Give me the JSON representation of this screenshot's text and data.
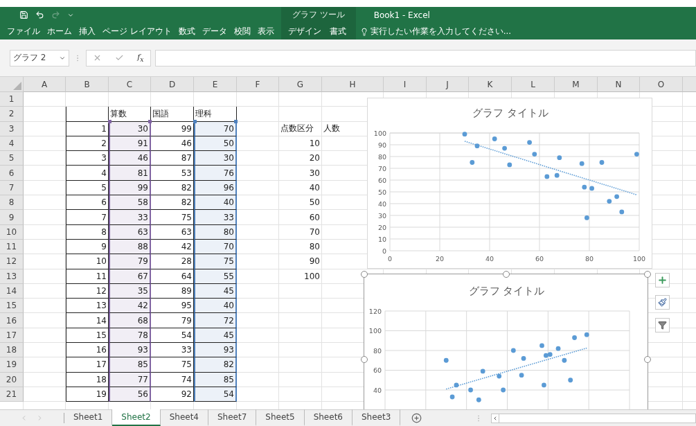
{
  "window": {
    "title": "Book1 - Excel"
  },
  "ribbon": {
    "tab_group": "グラフ ツール",
    "tabs": [
      {
        "label": "ファイル",
        "kind": "main"
      },
      {
        "label": "ホーム",
        "kind": "main"
      },
      {
        "label": "挿入",
        "kind": "main"
      },
      {
        "label": "ページ レイアウト",
        "kind": "main"
      },
      {
        "label": "数式",
        "kind": "main"
      },
      {
        "label": "データ",
        "kind": "main"
      },
      {
        "label": "校閲",
        "kind": "main"
      },
      {
        "label": "表示",
        "kind": "main"
      },
      {
        "label": "デザイン",
        "kind": "contextual"
      },
      {
        "label": "書式",
        "kind": "contextual"
      }
    ],
    "tell_me": {
      "placeholder": "実行したい作業を入力してください..."
    }
  },
  "formula_bar": {
    "name_box": "グラフ 2",
    "function_label": "f$_{x}$"
  },
  "sheet": {
    "columns": [
      {
        "label": "A"
      },
      {
        "label": "B",
        "bordered": true
      },
      {
        "label": "C",
        "bordered": true,
        "color": "#8064a2"
      },
      {
        "label": "D",
        "bordered": true
      },
      {
        "label": "E",
        "bordered": true,
        "color": "#4f81bd"
      },
      {
        "label": "F"
      },
      {
        "label": "G"
      },
      {
        "label": "H"
      },
      {
        "label": "I"
      },
      {
        "label": "J"
      },
      {
        "label": "K"
      },
      {
        "label": "L"
      },
      {
        "label": "M"
      },
      {
        "label": "N"
      },
      {
        "label": "O"
      }
    ],
    "rows": [
      {
        "number": "1"
      },
      {
        "number": "2",
        "bordered": true,
        "in_range": false,
        "cells": [
          null,
          null,
          {
            "text": "算数",
            "kind": "text"
          },
          {
            "text": "国語",
            "kind": "text"
          },
          {
            "text": "理科",
            "kind": "text"
          }
        ]
      },
      {
        "number": "3",
        "bordered": true,
        "in_range": true,
        "cells": [
          null,
          "1",
          "30",
          "99",
          "70",
          null,
          {
            "text": "点数区分",
            "kind": "text"
          },
          {
            "text": "人数",
            "kind": "text"
          }
        ]
      },
      {
        "number": "4",
        "bordered": true,
        "in_range": true,
        "cells": [
          null,
          "2",
          "91",
          "46",
          "50",
          null,
          "10"
        ]
      },
      {
        "number": "5",
        "bordered": true,
        "in_range": true,
        "cells": [
          null,
          "3",
          "46",
          "87",
          "30",
          null,
          "20"
        ]
      },
      {
        "number": "6",
        "bordered": true,
        "in_range": true,
        "cells": [
          null,
          "4",
          "81",
          "53",
          "76",
          null,
          "30"
        ]
      },
      {
        "number": "7",
        "bordered": true,
        "in_range": true,
        "cells": [
          null,
          "5",
          "99",
          "82",
          "96",
          null,
          "40"
        ]
      },
      {
        "number": "8",
        "bordered": true,
        "in_range": true,
        "cells": [
          null,
          "6",
          "58",
          "82",
          "40",
          null,
          "50"
        ]
      },
      {
        "number": "9",
        "bordered": true,
        "in_range": true,
        "cells": [
          null,
          "7",
          "33",
          "75",
          "33",
          null,
          "60"
        ]
      },
      {
        "number": "10",
        "bordered": true,
        "in_range": true,
        "cells": [
          null,
          "8",
          "63",
          "63",
          "80",
          null,
          "70"
        ]
      },
      {
        "number": "11",
        "bordered": true,
        "in_range": true,
        "cells": [
          null,
          "9",
          "88",
          "42",
          "70",
          null,
          "80"
        ]
      },
      {
        "number": "12",
        "bordered": true,
        "in_range": true,
        "cells": [
          null,
          "10",
          "79",
          "28",
          "75",
          null,
          "90"
        ]
      },
      {
        "number": "13",
        "bordered": true,
        "in_range": true,
        "cells": [
          null,
          "11",
          "67",
          "64",
          "55",
          null,
          "100"
        ]
      },
      {
        "number": "14",
        "bordered": true,
        "in_range": true,
        "cells": [
          null,
          "12",
          "35",
          "89",
          "45"
        ]
      },
      {
        "number": "15",
        "bordered": true,
        "in_range": true,
        "cells": [
          null,
          "13",
          "42",
          "95",
          "40"
        ]
      },
      {
        "number": "16",
        "bordered": true,
        "in_range": true,
        "cells": [
          null,
          "14",
          "68",
          "79",
          "72"
        ]
      },
      {
        "number": "17",
        "bordered": true,
        "in_range": true,
        "cells": [
          null,
          "15",
          "78",
          "54",
          "45"
        ]
      },
      {
        "number": "18",
        "bordered": true,
        "in_range": true,
        "cells": [
          null,
          "16",
          "93",
          "33",
          "93"
        ]
      },
      {
        "number": "19",
        "bordered": true,
        "in_range": true,
        "cells": [
          null,
          "17",
          "85",
          "75",
          "82"
        ]
      },
      {
        "number": "20",
        "bordered": true,
        "in_range": true,
        "cells": [
          null,
          "18",
          "77",
          "74",
          "85"
        ]
      },
      {
        "number": "21",
        "bordered": true,
        "in_range": true,
        "cells": [
          null,
          "19",
          "56",
          "92",
          "54"
        ]
      }
    ]
  },
  "charts": [
    {
      "selected": false,
      "chart_data": {
        "type": "scatter",
        "title": "グラフ タイトル",
        "grid": true,
        "x": [
          30,
          33,
          35,
          42,
          46,
          48,
          56,
          58,
          63,
          67,
          68,
          77,
          78,
          79,
          81,
          85,
          88,
          91,
          93,
          99
        ],
        "series": [
          {
            "color": "#5b9bd5",
            "values": [
              99,
              75,
              89,
              95,
              87,
              73,
              92,
              82,
              63,
              64,
              79,
              74,
              54,
              28,
              53,
              75,
              42,
              46,
              33,
              82
            ]
          },
          {
            "type": "line",
            "line_style": "dotted",
            "color": "#5b9bd5",
            "values": [
              93.0,
              91.0,
              89.7,
              85.1,
              82.4,
              81.1,
              75.9,
              74.5,
              71.2,
              68.6,
              67.9,
              62.0,
              61.3,
              60.7,
              59.4,
              56.7,
              54.8,
              52.8,
              51.5,
              47.5
            ]
          }
        ],
        "xlim": [
          0,
          100
        ],
        "ylim": [
          0,
          100
        ],
        "xticks": [
          0,
          20,
          40,
          60,
          80,
          100
        ],
        "yticks": [
          0,
          10,
          20,
          30,
          40,
          50,
          60,
          70,
          80,
          90,
          100
        ]
      }
    },
    {
      "selected": true,
      "kind": "picture",
      "trendline": true,
      "title": "グラフ タイトル",
      "axis_labels": [
        "120",
        "100",
        "80",
        "60",
        "40"
      ]
    }
  ],
  "sheet_tabs": [
    {
      "label": "Sheet1",
      "selected": false
    },
    {
      "label": "Sheet2",
      "selected": true
    },
    {
      "label": "Sheet4",
      "selected": false
    },
    {
      "label": "Sheet7",
      "selected": false
    },
    {
      "label": "Sheet5",
      "selected": false
    },
    {
      "label": "Sheet6",
      "selected": false
    },
    {
      "label": "Sheet3",
      "selected": false
    }
  ]
}
